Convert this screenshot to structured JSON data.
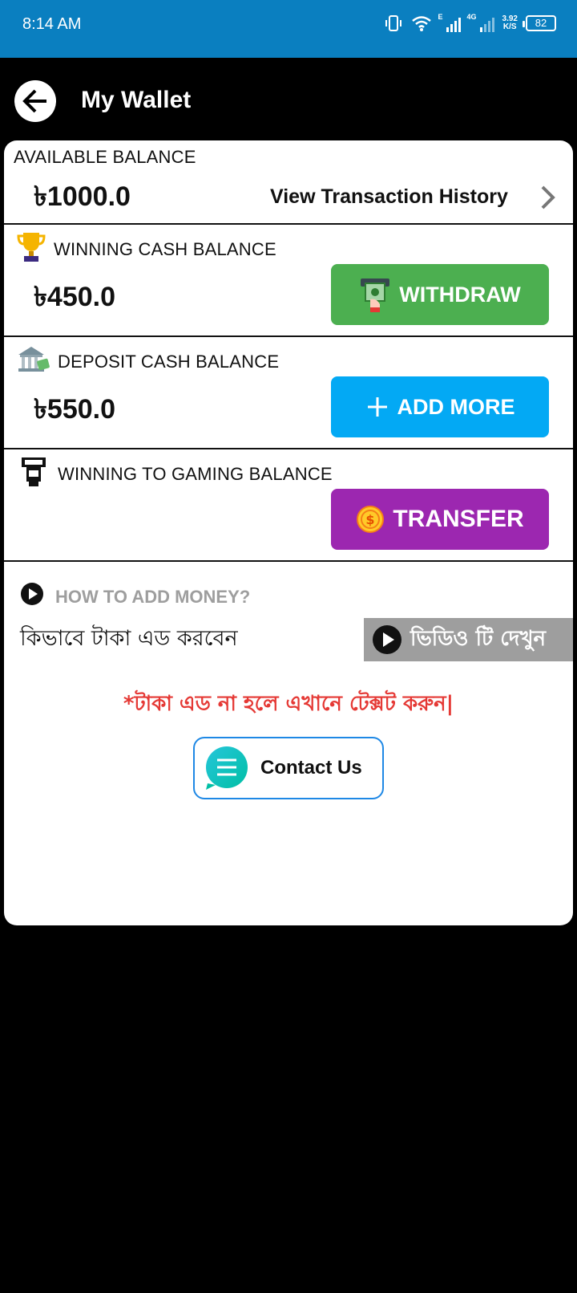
{
  "status_bar": {
    "time": "8:14 AM",
    "net_speed_value": "3.92",
    "net_speed_unit": "K/S",
    "network_type_1": "E",
    "network_type_2": "4G",
    "battery": "82"
  },
  "app_bar": {
    "title": "My Wallet"
  },
  "available_balance": {
    "label": "AVAILABLE BALANCE",
    "amount": "৳1000.0",
    "history_link": "View Transaction History"
  },
  "winning_cash": {
    "label": "WINNING CASH BALANCE",
    "amount": "৳450.0",
    "button": "WITHDRAW"
  },
  "deposit_cash": {
    "label": "DEPOSIT CASH BALANCE",
    "amount": "৳550.0",
    "button": "ADD MORE"
  },
  "winning_to_gaming": {
    "label": "WINNING TO GAMING BALANCE",
    "button": "TRANSFER"
  },
  "how_to": {
    "label": "HOW TO ADD MONEY?",
    "bangla_text": "কিভাবে টাকা এড করবেন",
    "video_button": "ভিডিও টি দেখুন"
  },
  "warning_text": "*টাকা এড না হলে এখানে টেক্সট করুন|",
  "contact_button": "Contact Us",
  "colors": {
    "status_bar": "#0a7fc0",
    "withdraw": "#4caf50",
    "add_more": "#03a9f4",
    "transfer": "#9c27b0",
    "warning": "#e53935"
  }
}
